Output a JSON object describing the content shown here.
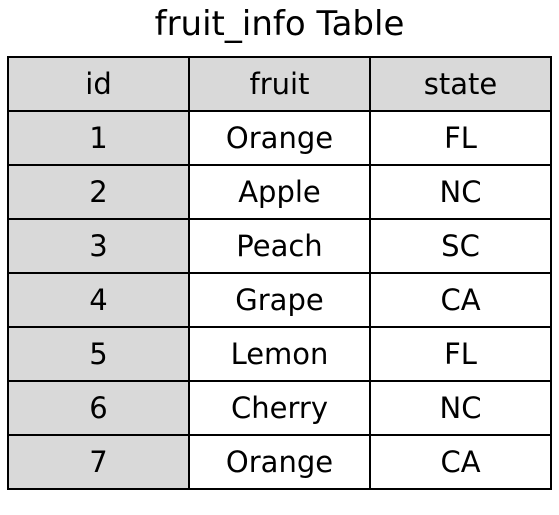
{
  "title": "fruit_info Table",
  "table": {
    "columns": [
      "id",
      "fruit",
      "state"
    ],
    "rows": [
      [
        "1",
        "Orange",
        "FL"
      ],
      [
        "2",
        "Apple",
        "NC"
      ],
      [
        "3",
        "Peach",
        "SC"
      ],
      [
        "4",
        "Grape",
        "CA"
      ],
      [
        "5",
        "Lemon",
        "FL"
      ],
      [
        "6",
        "Cherry",
        "NC"
      ],
      [
        "7",
        "Orange",
        "CA"
      ]
    ]
  },
  "colors": {
    "header_bg": "#d9d9d9",
    "id_col_bg": "#d9d9d9",
    "border": "#000000"
  }
}
